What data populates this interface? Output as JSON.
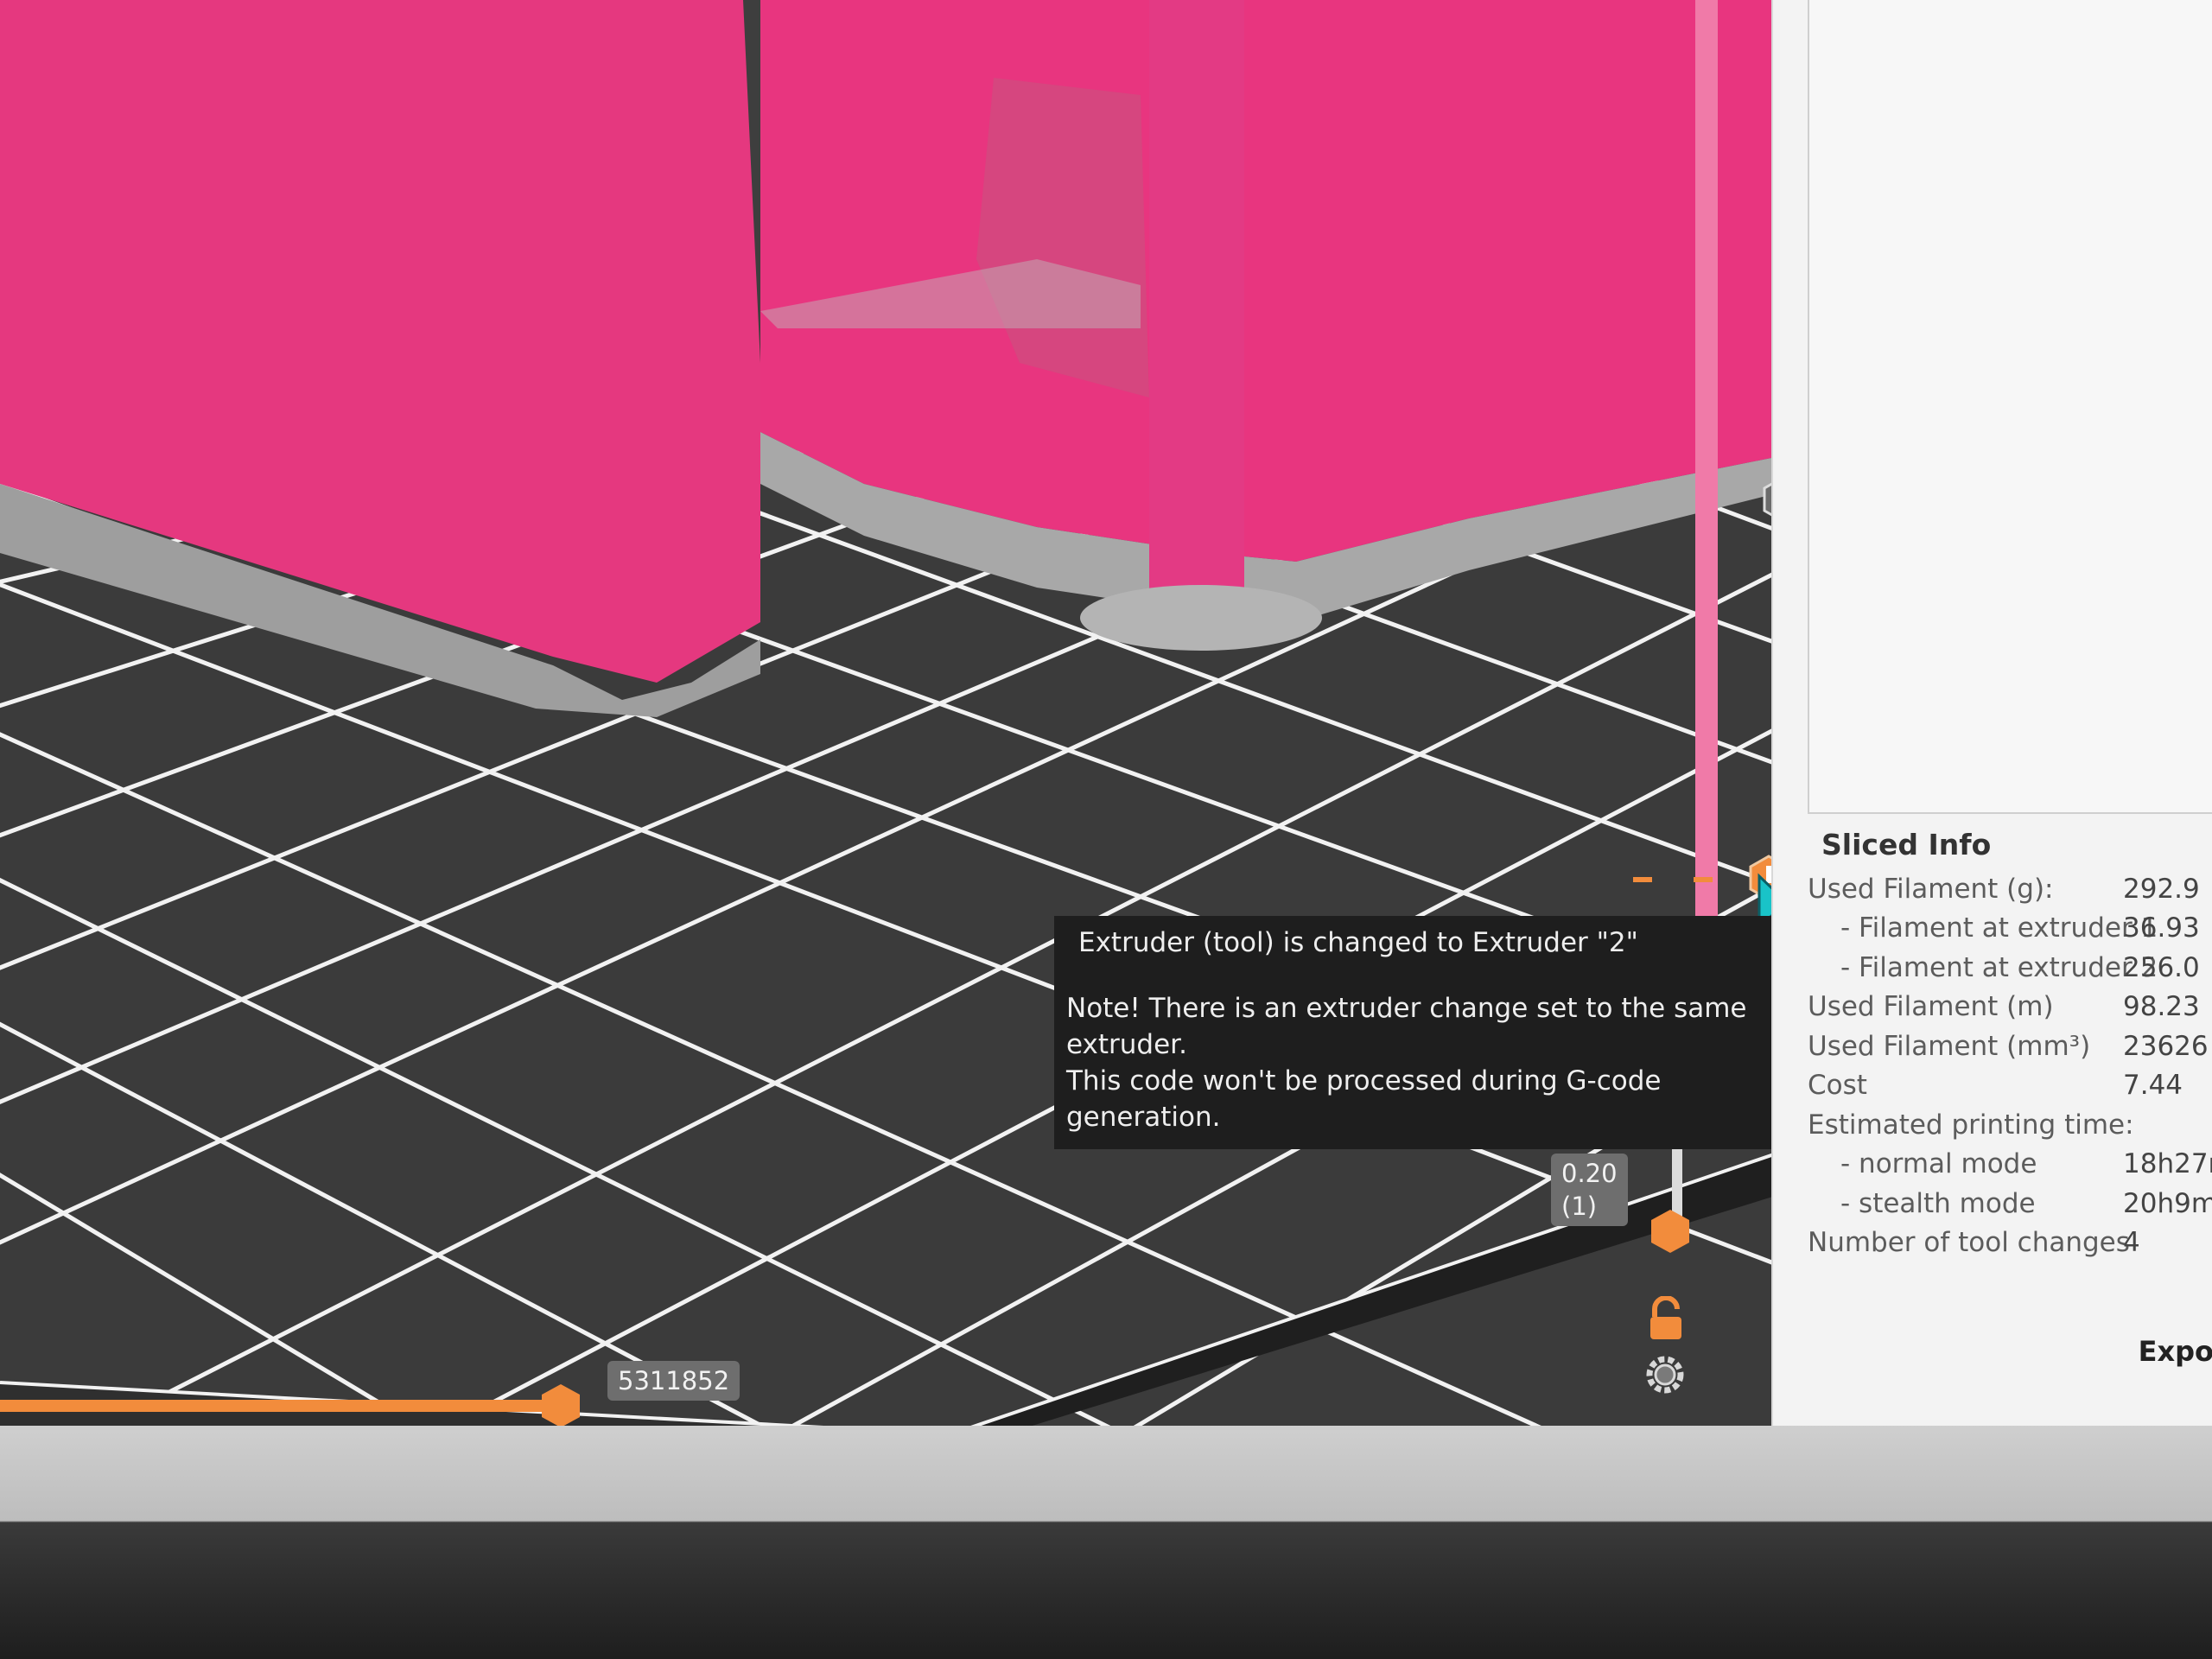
{
  "tooltip": {
    "title": "Extruder (tool) is changed to Extruder \"2\"",
    "note_line1": "Note! There is an extruder change set to the same",
    "note_line2": "extruder.",
    "note_line3": "This code won't be processed during G-code generation."
  },
  "vertical_slider": {
    "layer_height": "0.20",
    "layer_index": "(1)"
  },
  "horizontal_slider": {
    "move_number": "5311852"
  },
  "sliced_info": {
    "title": "Sliced Info",
    "rows": [
      {
        "label": "Used Filament (g):",
        "value": "292.9"
      },
      {
        "label": "- Filament at extruder 1",
        "value": "36.93"
      },
      {
        "label": "- Filament at extruder 2",
        "value": "256.0"
      },
      {
        "label": "Used Filament (m)",
        "value": "98.23"
      },
      {
        "label": "Used Filament (mm³)",
        "value": "23626"
      },
      {
        "label": "Cost",
        "value": "7.44"
      },
      {
        "label": "Estimated printing time:",
        "value": ""
      },
      {
        "label": "- normal mode",
        "value": "18h27r"
      },
      {
        "label": "- stealth mode",
        "value": "20h9m"
      },
      {
        "label": "Number of tool changes",
        "value": "4"
      }
    ]
  },
  "export_label": "Expo",
  "colors": {
    "model_pink": "#e8357f",
    "bed_dark": "#3e3e3e",
    "grid_white": "#f4f4f4",
    "slider_orange": "#f28c3c",
    "tooltip_bg": "#1e1e1e"
  },
  "icons": [
    "warning-marker-icon",
    "mouse-cursor-icon",
    "lock-icon",
    "settings-cog-icon",
    "slider-thumb-icon"
  ]
}
